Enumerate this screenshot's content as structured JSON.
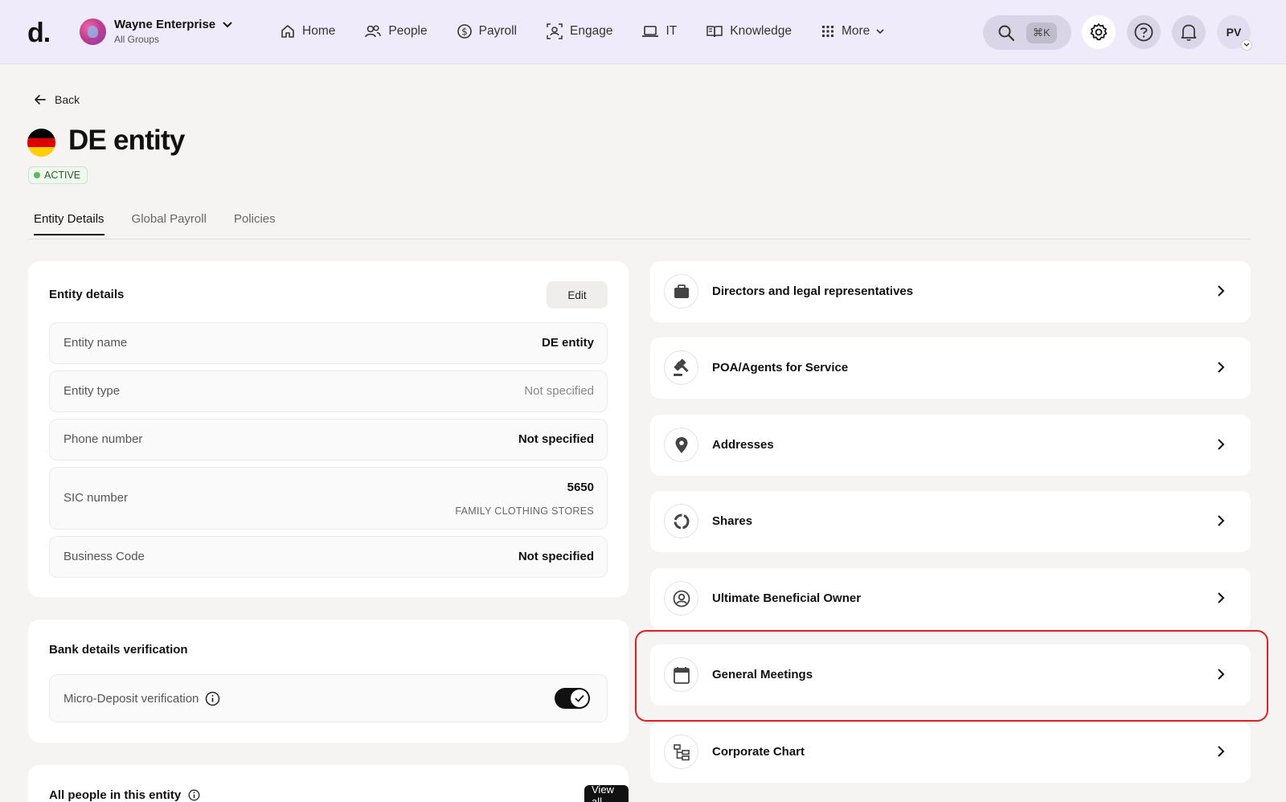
{
  "logo": "d.",
  "org": {
    "name": "Wayne Enterprise",
    "sub": "All Groups"
  },
  "nav": [
    {
      "label": "Home",
      "icon": "home-icon"
    },
    {
      "label": "People",
      "icon": "people-icon"
    },
    {
      "label": "Payroll",
      "icon": "dollar-icon"
    },
    {
      "label": "Engage",
      "icon": "engage-icon"
    },
    {
      "label": "IT",
      "icon": "laptop-icon"
    },
    {
      "label": "Knowledge",
      "icon": "book-icon"
    },
    {
      "label": "More",
      "icon": "grid-icon"
    }
  ],
  "search": {
    "shortcut": "⌘K"
  },
  "user": {
    "initials": "PV"
  },
  "page": {
    "back": "Back",
    "title": "DE entity",
    "status": "ACTIVE",
    "tabs": [
      "Entity Details",
      "Global Payroll",
      "Policies"
    ]
  },
  "entity_details": {
    "title": "Entity details",
    "edit": "Edit",
    "rows": [
      {
        "label": "Entity name",
        "value": "DE entity"
      },
      {
        "label": "Entity type",
        "value": "Not specified"
      },
      {
        "label": "Phone number",
        "value": "Not specified"
      },
      {
        "label": "SIC number",
        "value": "5650",
        "sub": "FAMILY CLOTHING STORES"
      },
      {
        "label": "Business Code",
        "value": "Not specified"
      }
    ]
  },
  "bank": {
    "title": "Bank details verification",
    "row_label": "Micro-Deposit verification",
    "toggle_on": true
  },
  "people": {
    "title": "All people in this entity",
    "view_all": "View all"
  },
  "links": [
    {
      "label": "Directors and legal representatives",
      "icon": "briefcase-icon"
    },
    {
      "label": "POA/Agents for Service",
      "icon": "gavel-icon"
    },
    {
      "label": "Addresses",
      "icon": "location-pin-icon"
    },
    {
      "label": "Shares",
      "icon": "pie-ring-icon"
    },
    {
      "label": "Ultimate Beneficial Owner",
      "icon": "user-circle-icon"
    },
    {
      "label": "General Meetings",
      "icon": "calendar-icon"
    },
    {
      "label": "Corporate Chart",
      "icon": "org-chart-icon"
    }
  ],
  "flag_colors": [
    "#000000",
    "#dd0000",
    "#ffce00"
  ],
  "highlight_color": "#e02020"
}
